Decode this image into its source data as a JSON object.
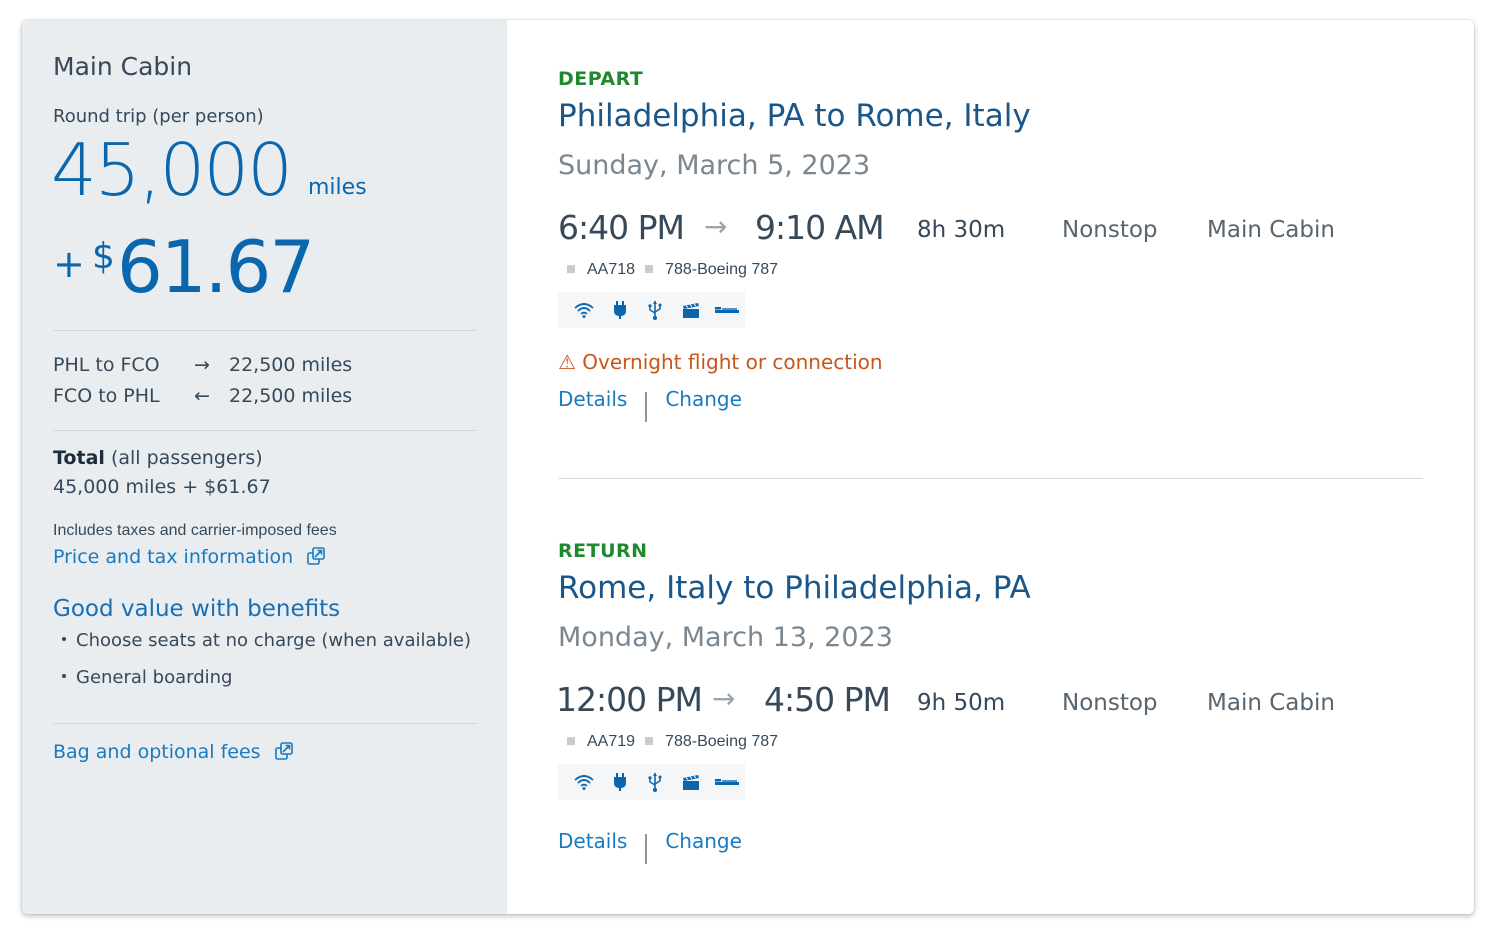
{
  "summary": {
    "cabin_title": "Main Cabin",
    "trip_label": "Round trip (per person)",
    "miles": "45,000",
    "miles_unit": "miles",
    "plus": "+",
    "currency_symbol": "$",
    "fee": "61.67",
    "segments": [
      {
        "route": "PHL to FCO",
        "arrow": "→",
        "miles": "22,500 miles"
      },
      {
        "route": "FCO to PHL",
        "arrow": "←",
        "miles": "22,500 miles"
      }
    ],
    "total_bold": "Total",
    "total_suffix": " (all passengers)",
    "total_value": "45,000 miles + $61.67",
    "includes_note": "Includes taxes and carrier-imposed fees",
    "price_tax_link": "Price and tax information",
    "benefits_title": "Good value with benefits",
    "benefits": [
      "Choose seats at no charge (when available)",
      "General boarding"
    ],
    "bag_fees_link": "Bag and optional fees"
  },
  "flights": [
    {
      "direction": "DEPART",
      "route": "Philadelphia, PA to Rome, Italy",
      "date": "Sunday, March 5, 2023",
      "depart_time": "6:40 PM",
      "arrow": "→",
      "arrive_time": "9:10 AM",
      "duration": "8h 30m",
      "stops": "Nonstop",
      "cabin": "Main Cabin",
      "flight_number": "AA718",
      "aircraft": "788-Boeing 787",
      "amenities": [
        "wifi",
        "power",
        "usb",
        "entertainment",
        "lie-flat"
      ],
      "warning_icon": "⚠",
      "warning": "Overnight flight or connection",
      "details_label": "Details",
      "change_label": "Change"
    },
    {
      "direction": "RETURN",
      "route": "Rome, Italy to Philadelphia, PA",
      "date": "Monday, March 13, 2023",
      "depart_time": "12:00 PM",
      "arrow": "→",
      "arrive_time": "4:50 PM",
      "duration": "9h 50m",
      "stops": "Nonstop",
      "cabin": "Main Cabin",
      "flight_number": "AA719",
      "aircraft": "788-Boeing 787",
      "amenities": [
        "wifi",
        "power",
        "usb",
        "entertainment",
        "lie-flat"
      ],
      "details_label": "Details",
      "change_label": "Change"
    }
  ],
  "colors": {
    "brand_blue": "#0b67ad",
    "link_blue": "#1a7ac0",
    "direction_green": "#1e8a2f",
    "warning_orange": "#c8561c",
    "panel_gray": "#e9edf0"
  }
}
